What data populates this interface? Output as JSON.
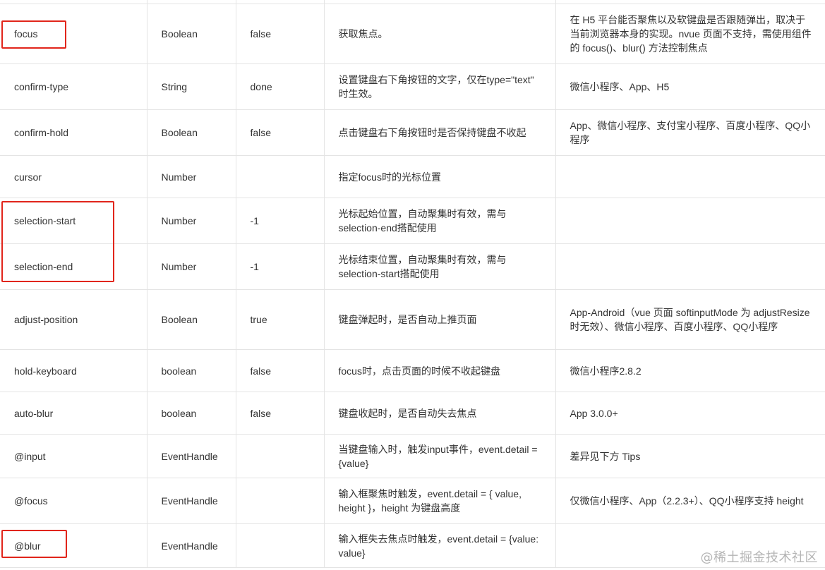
{
  "rows": [
    {
      "name": "focus",
      "type": "Boolean",
      "default": "false",
      "desc": "获取焦点。",
      "platform": "在 H5 平台能否聚焦以及软键盘是否跟随弹出，取决于当前浏览器本身的实现。nvue 页面不支持，需使用组件的 focus()、blur() 方法控制焦点"
    },
    {
      "name": "confirm-type",
      "type": "String",
      "default": "done",
      "desc": "设置键盘右下角按钮的文字，仅在type=\"text\" 时生效。",
      "platform": "微信小程序、App、H5"
    },
    {
      "name": "confirm-hold",
      "type": "Boolean",
      "default": "false",
      "desc": "点击键盘右下角按钮时是否保持键盘不收起",
      "platform": "App、微信小程序、支付宝小程序、百度小程序、QQ小程序"
    },
    {
      "name": "cursor",
      "type": "Number",
      "default": "",
      "desc": "指定focus时的光标位置",
      "platform": ""
    },
    {
      "name": "selection-start",
      "type": "Number",
      "default": "-1",
      "desc": "光标起始位置，自动聚集时有效，需与selection-end搭配使用",
      "platform": ""
    },
    {
      "name": "selection-end",
      "type": "Number",
      "default": "-1",
      "desc": "光标结束位置，自动聚集时有效，需与selection-start搭配使用",
      "platform": ""
    },
    {
      "name": "adjust-position",
      "type": "Boolean",
      "default": "true",
      "desc": "键盘弹起时，是否自动上推页面",
      "platform": "App-Android（vue 页面 softinputMode 为 adjustResize 时无效）、微信小程序、百度小程序、QQ小程序"
    },
    {
      "name": "hold-keyboard",
      "type": "boolean",
      "default": "false",
      "desc": "focus时，点击页面的时候不收起键盘",
      "platform": "微信小程序2.8.2"
    },
    {
      "name": "auto-blur",
      "type": "boolean",
      "default": "false",
      "desc": "键盘收起时，是否自动失去焦点",
      "platform": "App 3.0.0+"
    },
    {
      "name": "@input",
      "type": "EventHandle",
      "default": "",
      "desc": "当键盘输入时，触发input事件，event.detail = {value}",
      "platform": "差异见下方 Tips"
    },
    {
      "name": "@focus",
      "type": "EventHandle",
      "default": "",
      "desc": "输入框聚焦时触发，event.detail = { value, height }，height 为键盘高度",
      "platform": "仅微信小程序、App（2.2.3+）、QQ小程序支持 height"
    },
    {
      "name": "@blur",
      "type": "EventHandle",
      "default": "",
      "desc": "输入框失去焦点时触发，event.detail = {value: value}",
      "platform": ""
    }
  ],
  "watermark": "@稀土掘金技术社区",
  "accent_color": "#e1251b"
}
